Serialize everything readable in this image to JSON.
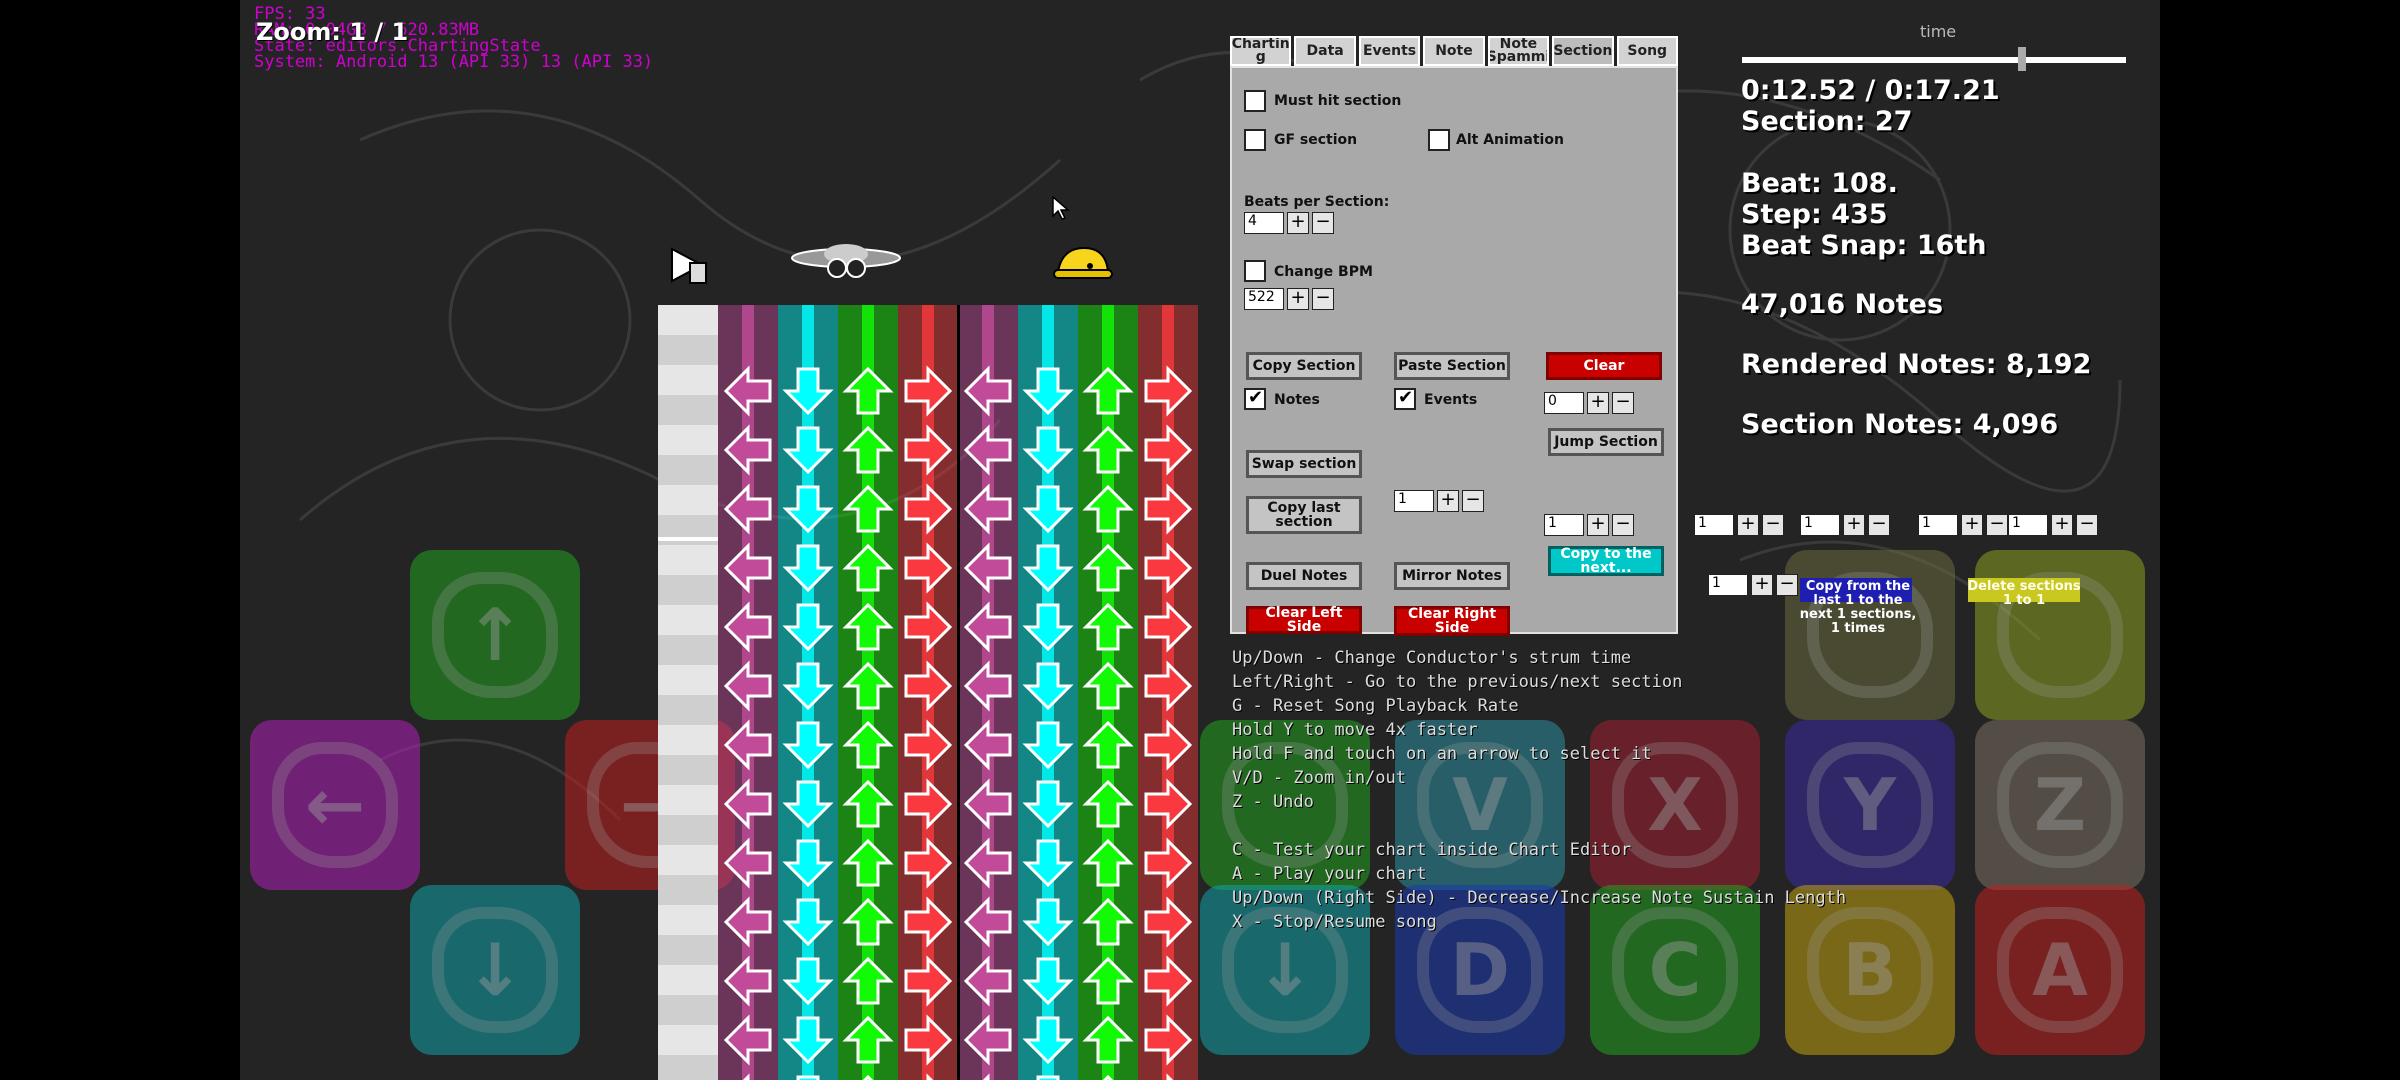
{
  "debug": {
    "fps": "FPS: 33",
    "memory": "RAM: 0.04GB / 620.83MB",
    "state": "State: editors.ChartingState",
    "system": "System: Android 13 (API 33) 13 (API 33)"
  },
  "zoom": "Zoom: 1 / 1",
  "timeline": {
    "label": "time",
    "progress": 0.73
  },
  "info": {
    "time": "0:12.52 / 0:17.21",
    "section": "Section: 27",
    "beat": "Beat: 108.",
    "step": "Step: 435",
    "snap": "Beat Snap: 16th",
    "notes": "47,016 Notes",
    "rendered": "Rendered Notes: 8,192",
    "section_notes": "Section Notes: 4,096"
  },
  "tabs": [
    {
      "label": "Chartin g"
    },
    {
      "label": "Data"
    },
    {
      "label": "Events"
    },
    {
      "label": "Note"
    },
    {
      "label": "Note Spammi"
    },
    {
      "label": "Section",
      "active": true
    },
    {
      "label": "Song"
    }
  ],
  "section": {
    "must_hit": "Must hit section",
    "gf": "GF section",
    "alt": "Alt Animation",
    "beats_label": "Beats per Section:",
    "beats_value": "4",
    "change_bpm": "Change BPM",
    "bpm_value": "522",
    "copy": "Copy Section",
    "paste": "Paste Section",
    "clear": "Clear",
    "notes": "Notes",
    "events": "Events",
    "jump_value": "0",
    "jump": "Jump Section",
    "swap": "Swap section",
    "copy_last": "Copy last section",
    "copy_last_value": "1",
    "copy_next_value": "1",
    "copy_next": "Copy to the next...",
    "duet": "Duel Notes",
    "mirror": "Mirror Notes",
    "clear_left": "Clear Left Side",
    "clear_right": "Clear Right Side"
  },
  "floating": {
    "s1": "1",
    "s2": "1",
    "s3": "1",
    "s4": "1",
    "s5": "1",
    "copy_from": "Copy from the last 1 to the next 1 sections, 1 times",
    "delete": "Delete sections 1 to 1"
  },
  "help": [
    "Up/Down - Change Conductor's strum time",
    "Left/Right - Go to the previous/next section",
    "G - Reset Song Playback Rate",
    "Hold Y to move 4x faster",
    "Hold F and touch on an arrow to select it",
    "V/D - Zoom in/out",
    "Z - Undo",
    "",
    "C - Test your chart inside Chart Editor",
    "A - Play your chart",
    "Up/Down (Right Side) - Decrease/Increase Note Sustain Length",
    "X - Stop/Resume song"
  ],
  "vpad": {
    "letters": [
      "V",
      "X",
      "Y",
      "Z",
      "D",
      "C",
      "B",
      "A"
    ]
  },
  "colors": {
    "purple": "#c24b99",
    "blue": "#00ffff",
    "green": "#12fa05",
    "red": "#f9393f"
  }
}
